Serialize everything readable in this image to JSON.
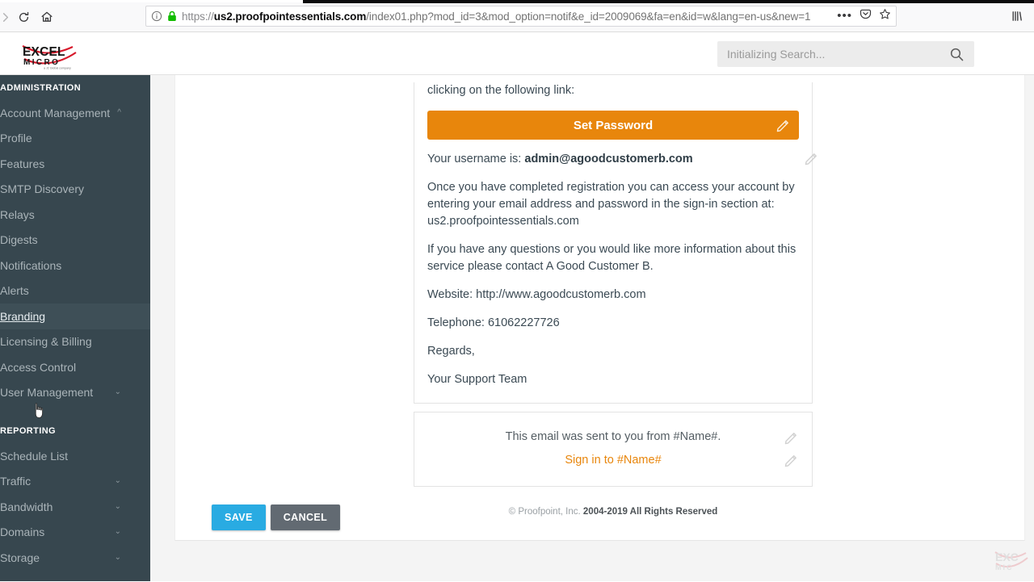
{
  "browser": {
    "url_scheme": "https://",
    "url_host_prefix": "us2.",
    "url_host_strong": "proofpointessentials.com",
    "url_path": "/index01.php?mod_id=3&mod_option=notif&e_id=2009069&fa=en&id=w&lang=en-us&new=1",
    "full_url": "https://us2.proofpointessentials.com/index01.php?mod_id=3&mod_option=notif&e_id=2009069&fa=en&id=w&lang=en-us&new=1",
    "page_action_dots": "•••",
    "icons": {
      "forward": "forward-arrow-icon",
      "reload": "reload-icon",
      "home": "home-icon",
      "info": "site-info-icon",
      "lock": "ssl-lock-icon",
      "pocket": "pocket-icon",
      "bookmark": "bookmark-star-icon",
      "library": "library-icon"
    }
  },
  "header": {
    "logo_primary": "EXCEL",
    "logo_secondary": "M I C R O",
    "logo_tagline": "a J2 Global company",
    "search_placeholder": "Initializing Search...",
    "search_value": "",
    "search_icon": "search-icon",
    "help_icon": "help-circle-icon"
  },
  "sidebar": {
    "sections": [
      {
        "title": "ADMINISTRATION",
        "items": [
          {
            "label": "Account Management",
            "chevron": "up",
            "active": false
          },
          {
            "label": "Profile",
            "chevron": "",
            "active": false
          },
          {
            "label": "Features",
            "chevron": "",
            "active": false
          },
          {
            "label": "SMTP Discovery",
            "chevron": "",
            "active": false
          },
          {
            "label": "Relays",
            "chevron": "",
            "active": false
          },
          {
            "label": "Digests",
            "chevron": "",
            "active": false
          },
          {
            "label": "Notifications",
            "chevron": "",
            "active": false
          },
          {
            "label": "Alerts",
            "chevron": "",
            "active": false
          },
          {
            "label": "Branding",
            "chevron": "",
            "active": true
          },
          {
            "label": "Licensing & Billing",
            "chevron": "",
            "active": false
          },
          {
            "label": "Access Control",
            "chevron": "",
            "active": false
          },
          {
            "label": "User Management",
            "chevron": "down",
            "active": false
          }
        ]
      },
      {
        "title": "REPORTING",
        "items": [
          {
            "label": "Schedule List",
            "chevron": "",
            "active": false
          },
          {
            "label": "Traffic",
            "chevron": "down",
            "active": false
          },
          {
            "label": "Bandwidth",
            "chevron": "down",
            "active": false
          },
          {
            "label": "Domains",
            "chevron": "down",
            "active": false
          },
          {
            "label": "Storage",
            "chevron": "down",
            "active": false
          }
        ]
      }
    ]
  },
  "email_preview": {
    "intro_line": "clicking on the following link:",
    "cta_button_label": "Set Password",
    "username_label": "Your username is:",
    "username_value": "admin@agoodcustomerb.com",
    "paragraph_access": "Once you have completed registration you can access your account by entering your email address and password in the sign-in section at: us2.proofpointessentials.com",
    "paragraph_questions": "If you have any questions or you would like more information about this service please contact A Good Customer B.",
    "website_line": "Website: http://www.agoodcustomerb.com",
    "telephone_line": "Telephone: 61062227726",
    "regards_line": "Regards,",
    "signature_line": "Your Support Team",
    "footer_sent_from": "This email was sent to you from #Name#.",
    "footer_signin_link": "Sign in to #Name#",
    "pencil_icon": "pencil-edit-icon"
  },
  "footer": {
    "copyright_prefix": "© Proofpoint, Inc.",
    "copyright_years": "2004-2019 All Rights Reserved"
  },
  "form_actions": {
    "save_label": "SAVE",
    "cancel_label": "CANCEL"
  },
  "colors": {
    "accent_orange": "#e8860c",
    "sidebar_bg": "#37474f",
    "save_blue": "#29abe2",
    "cancel_gray": "#626a72",
    "brand_red": "#d7182a"
  }
}
